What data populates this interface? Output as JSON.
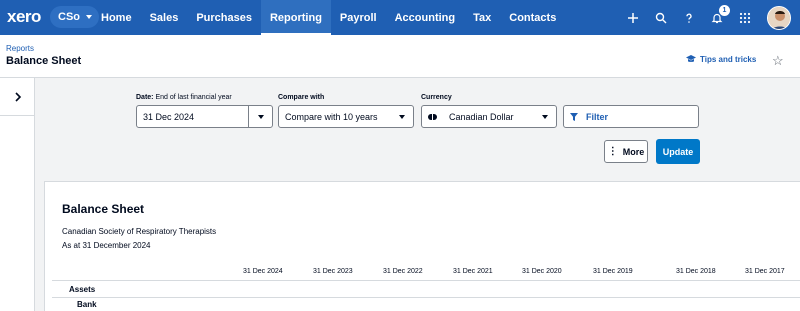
{
  "nav": {
    "logo": "xero",
    "org": "CSo",
    "links": [
      "Home",
      "Sales",
      "Purchases",
      "Reporting",
      "Payroll",
      "Accounting",
      "Tax",
      "Contacts"
    ],
    "active": "Reporting",
    "notifications_count": "1",
    "icons": [
      "plus-icon",
      "search-icon",
      "help-icon",
      "bell-icon",
      "apps-grid-icon"
    ]
  },
  "header": {
    "breadcrumb": "Reports",
    "title": "Balance Sheet",
    "tips": "Tips and tricks"
  },
  "filters": {
    "date": {
      "label": "Date:",
      "hint": "End of last financial year",
      "value": "31 Dec 2024"
    },
    "compare": {
      "label": "Compare with",
      "value": "Compare with 10 years"
    },
    "currency": {
      "label": "Currency",
      "value": "Canadian Dollar"
    },
    "filter_label": "Filter",
    "more_label": "More",
    "update_label": "Update"
  },
  "report": {
    "title": "Balance Sheet",
    "org_name": "Canadian Society of Respiratory Therapists",
    "as_at": "As at 31 December 2024",
    "columns": [
      "31 Dec 2024",
      "31 Dec 2023",
      "31 Dec 2022",
      "31 Dec 2021",
      "31 Dec 2020",
      "31 Dec 2019",
      "31 Dec 2018",
      "31 Dec 2017"
    ],
    "sections": [
      "Assets",
      "Bank"
    ]
  },
  "colors": {
    "nav_bg": "#1f5fb3",
    "accent": "#0078c8",
    "filter_bg": "#f2f3f4"
  }
}
